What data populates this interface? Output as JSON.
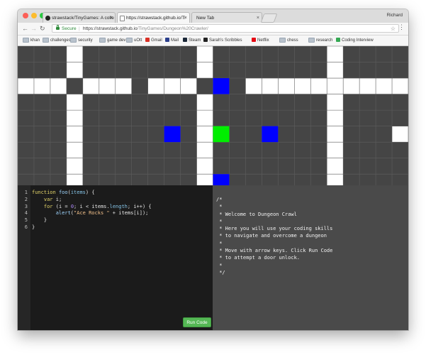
{
  "browser": {
    "tabs": [
      {
        "title": "strawstack/TinyGames: A colle",
        "active": false,
        "icon": "github-icon"
      },
      {
        "title": "https://strawstack.github.io/Ti",
        "active": true,
        "icon": "page-icon"
      },
      {
        "title": "New Tab",
        "active": false,
        "icon": "none"
      }
    ],
    "user": "Richard",
    "address": {
      "secure_label": "Secure",
      "separator": "|",
      "host": "https://strawstack.github.io",
      "path": "/TinyGames/Dungeon%20Crawler/"
    },
    "bookmarks": [
      {
        "label": "khan",
        "icon": "folder-icon"
      },
      {
        "label": "challenges",
        "icon": "folder-icon"
      },
      {
        "label": "security",
        "icon": "folder-icon"
      },
      {
        "label": "game dev",
        "icon": "folder-icon"
      },
      {
        "label": "uOtt",
        "icon": "folder-icon"
      },
      {
        "label": "Gmail",
        "icon": "gmail-icon"
      },
      {
        "label": "Mail",
        "icon": "mail-icon"
      },
      {
        "label": "Steam",
        "icon": "steam-icon"
      },
      {
        "label": "Sarah's Scribbles",
        "icon": "scribbles-icon"
      },
      {
        "label": "Netflix",
        "icon": "netflix-icon"
      },
      {
        "label": "chess",
        "icon": "folder-icon"
      },
      {
        "label": "research",
        "icon": "folder-icon"
      },
      {
        "label": "Coding Interview",
        "icon": "coding-icon"
      }
    ]
  },
  "game": {
    "colors": {
      "floor": "#454545",
      "wall": "#ffffff",
      "door": "#0000ff",
      "player": "#00ee00",
      "grid": "#5e5e5e"
    },
    "grid": [
      "...w.......w.......w....",
      "...w.......w.......w....",
      "www.www.www...wwwwwwwwww",
      "...w.......w.......w....",
      "...w.......w.......w....",
      "...w.......w.......w...w",
      "...w.......w.......w....",
      "...w.......w.......w...."
    ],
    "doors": [
      [
        2,
        12
      ],
      [
        5,
        9
      ],
      [
        5,
        15
      ],
      [
        8,
        12
      ]
    ],
    "player": [
      5,
      12
    ],
    "columns": 24,
    "rows": 8.7
  },
  "editor": {
    "lines": [
      [
        [
          "kw",
          "function"
        ],
        [
          "txt",
          " "
        ],
        [
          "fn",
          "foo"
        ],
        [
          "txt",
          "("
        ],
        [
          "prop",
          "items"
        ],
        [
          "txt",
          ") {"
        ]
      ],
      [
        [
          "txt",
          "    "
        ],
        [
          "kw",
          "var"
        ],
        [
          "txt",
          " i;"
        ]
      ],
      [
        [
          "txt",
          "    "
        ],
        [
          "kw",
          "for"
        ],
        [
          "txt",
          " (i = "
        ],
        [
          "num",
          "0"
        ],
        [
          "txt",
          "; i < items."
        ],
        [
          "prop",
          "length"
        ],
        [
          "txt",
          "; i++) {"
        ]
      ],
      [
        [
          "txt",
          "        "
        ],
        [
          "fn",
          "alert"
        ],
        [
          "txt",
          "("
        ],
        [
          "str",
          "\"Ace Rocks \""
        ],
        [
          "txt",
          " + items[i]);"
        ]
      ],
      [
        [
          "txt",
          "    }"
        ]
      ],
      [
        [
          "txt",
          "}"
        ]
      ]
    ],
    "run_label": "Run Code"
  },
  "info": {
    "lines": [
      "/*",
      " *",
      " * Welcome to Dungeon Crawl",
      " *",
      " * Here you will use your coding skills",
      " * to navigate and overcome a dungeon",
      " *",
      " * Move with arrow keys. Click Run Code",
      " * to attempt a door unlock.",
      " *",
      " */"
    ]
  }
}
